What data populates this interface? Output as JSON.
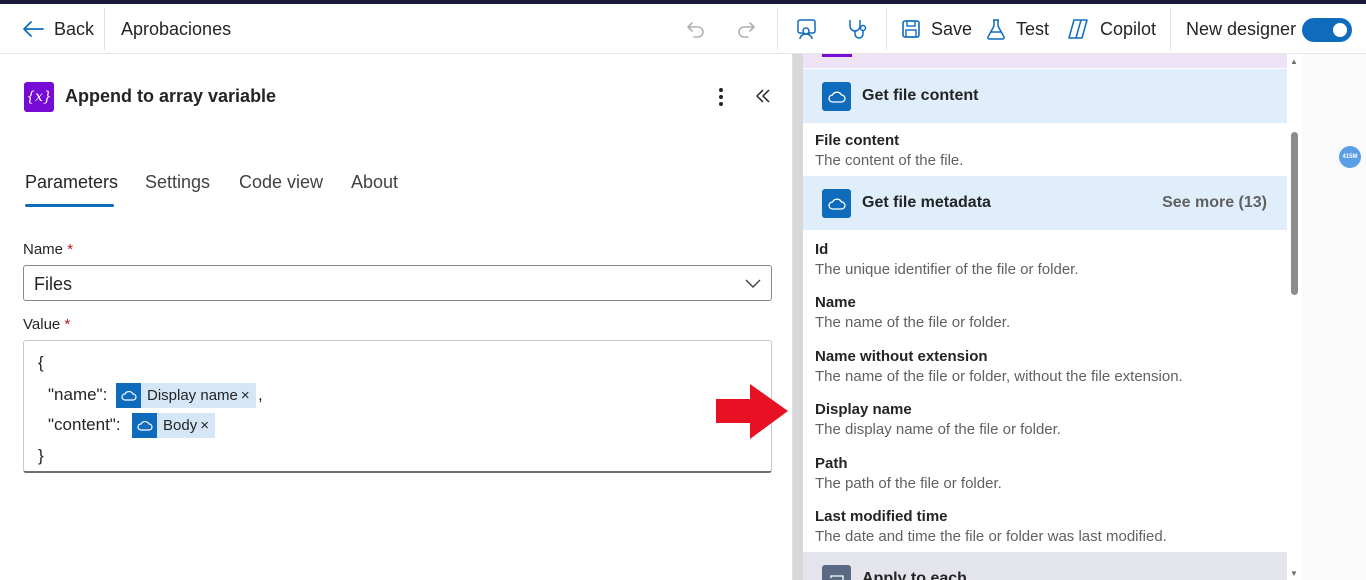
{
  "header": {
    "back_label": "Back",
    "flow_name": "Aprobaciones",
    "save_label": "Save",
    "test_label": "Test",
    "copilot_label": "Copilot",
    "new_designer_label": "New designer",
    "new_designer_on": true
  },
  "action": {
    "icon_text": "{x}",
    "title": "Append to array variable"
  },
  "tabs": [
    {
      "label": "Parameters",
      "active": true
    },
    {
      "label": "Settings",
      "active": false
    },
    {
      "label": "Code view",
      "active": false
    },
    {
      "label": "About",
      "active": false
    }
  ],
  "fields": {
    "name_label": "Name",
    "name_value": "Files",
    "value_label": "Value",
    "required_mark": "*"
  },
  "value_editor": {
    "open_brace": "{",
    "name_key": "\"name\":",
    "name_token": "Display name",
    "comma": ",",
    "content_key": "\"content\":",
    "content_token": "Body",
    "close_brace": "}",
    "token_remove": "×"
  },
  "dynamic_content": {
    "groups": [
      {
        "name": "Get file content",
        "see_more": ""
      },
      {
        "name": "Get file metadata",
        "see_more": "See more (13)"
      },
      {
        "name": "Apply to each",
        "see_more": ""
      }
    ],
    "file_content_items": [
      {
        "title": "File content",
        "desc": "The content of the file."
      }
    ],
    "metadata_items": [
      {
        "title": "Id",
        "desc": "The unique identifier of the file or folder."
      },
      {
        "title": "Name",
        "desc": "The name of the file or folder."
      },
      {
        "title": "Name without extension",
        "desc": "The name of the file or folder, without the file extension."
      },
      {
        "title": "Display name",
        "desc": "The display name of the file or folder."
      },
      {
        "title": "Path",
        "desc": "The path of the file or folder."
      },
      {
        "title": "Last modified time",
        "desc": "The date and time the file or folder was last modified."
      }
    ]
  },
  "side_badge": "415M",
  "colors": {
    "accent": "#0f6cbd",
    "variable_purple": "#770bd6",
    "arrow_red": "#e81123"
  }
}
